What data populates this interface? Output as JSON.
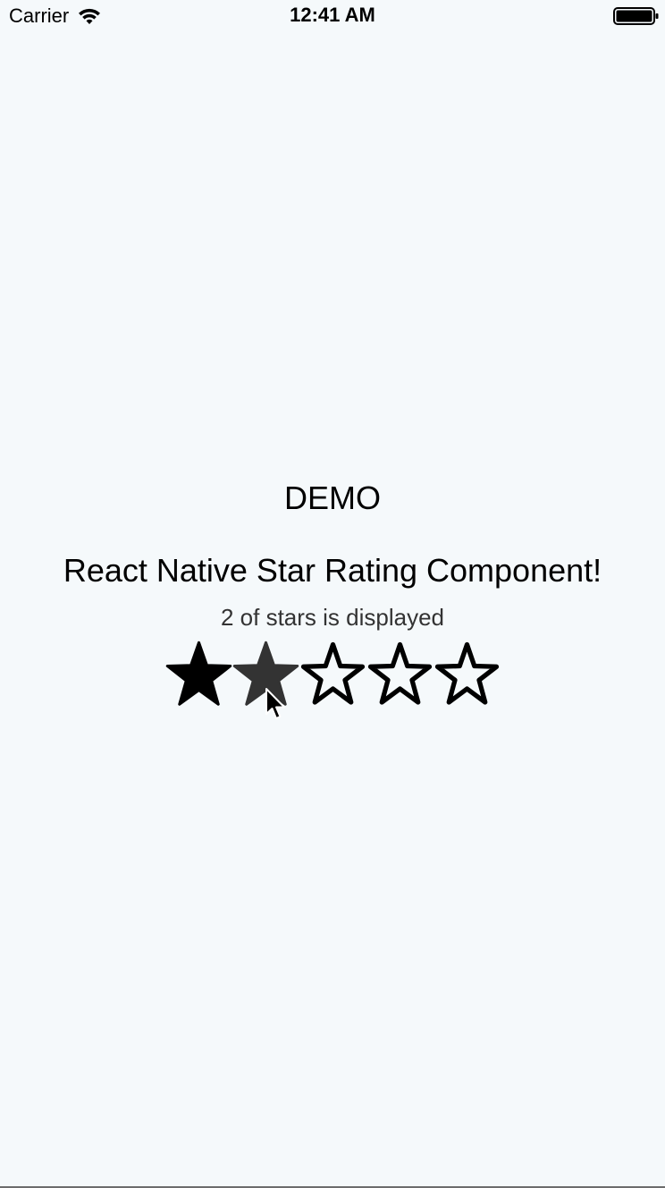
{
  "status_bar": {
    "carrier": "Carrier",
    "time": "12:41 AM",
    "icons": [
      "wifi-icon",
      "battery-icon"
    ]
  },
  "main": {
    "title": "DEMO",
    "subtitle": "React Native Star Rating Component!",
    "caption": "2 of stars is displayed"
  },
  "rating": {
    "value": 2,
    "max": 5,
    "filled_color": "#000000",
    "hover_color": "#333333",
    "empty_color": "#000000"
  },
  "colors": {
    "background": "#f5f9fb",
    "text": "#000000",
    "caption": "#333333"
  }
}
